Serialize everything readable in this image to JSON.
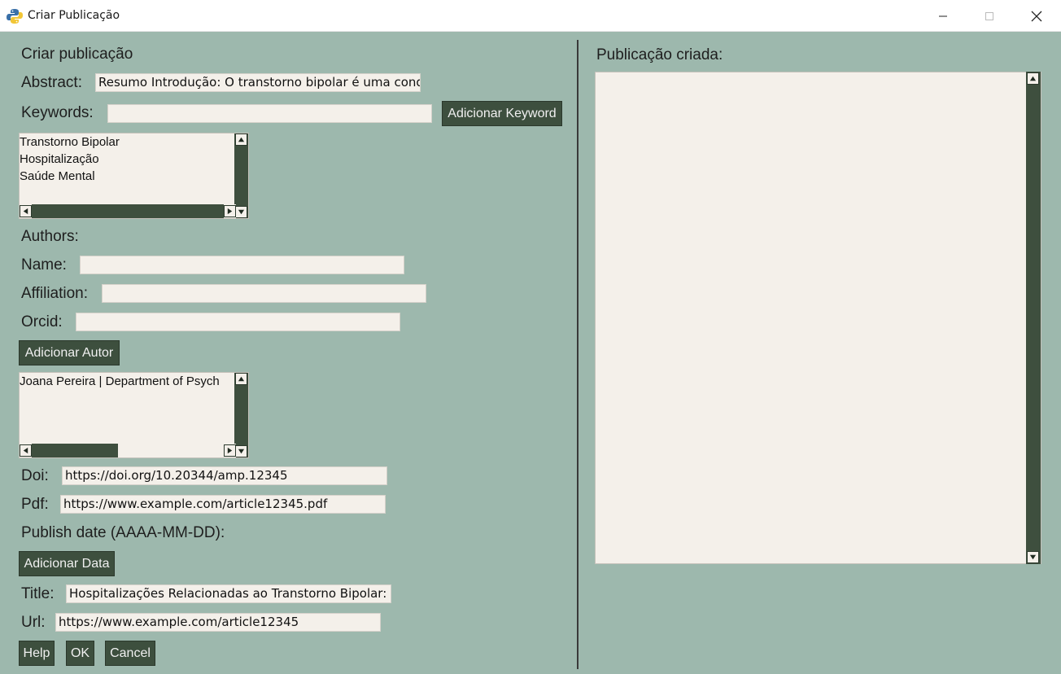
{
  "window": {
    "title": "Criar Publicação",
    "icon": "python-icon"
  },
  "form": {
    "heading": "Criar publicação",
    "abstract_label": "Abstract:",
    "abstract_value": "Resumo Introdução: O transtorno bipolar é uma condiç",
    "keywords_label": "Keywords:",
    "keywords_value": "",
    "add_keyword_button": "Adicionar Keyword",
    "keywords_list": [
      "Transtorno Bipolar",
      "Hospitalização",
      "Saúde Mental"
    ],
    "authors_label": "Authors:",
    "name_label": "Name:",
    "name_value": "",
    "affiliation_label": "Affiliation:",
    "affiliation_value": "",
    "orcid_label": "Orcid:",
    "orcid_value": "",
    "add_author_button": "Adicionar Autor",
    "authors_list": [
      "Joana Pereira | Department of Psych"
    ],
    "doi_label": "Doi:",
    "doi_value": "https://doi.org/10.20344/amp.12345",
    "pdf_label": "Pdf:",
    "pdf_value": "https://www.example.com/article12345.pdf",
    "publish_date_label": "Publish date (AAAA-MM-DD):",
    "add_date_button": "Adicionar Data",
    "title_label": "Title:",
    "title_value": "Hospitalizações Relacionadas ao Transtorno Bipolar: U",
    "url_label": "Url:",
    "url_value": "https://www.example.com/article12345",
    "help_button": "Help",
    "ok_button": "OK",
    "cancel_button": "Cancel"
  },
  "output": {
    "label": "Publicação criada:",
    "text": ""
  },
  "colors": {
    "background": "#9db8ad",
    "button": "#3d4f3e",
    "field": "#f4f0ea"
  }
}
